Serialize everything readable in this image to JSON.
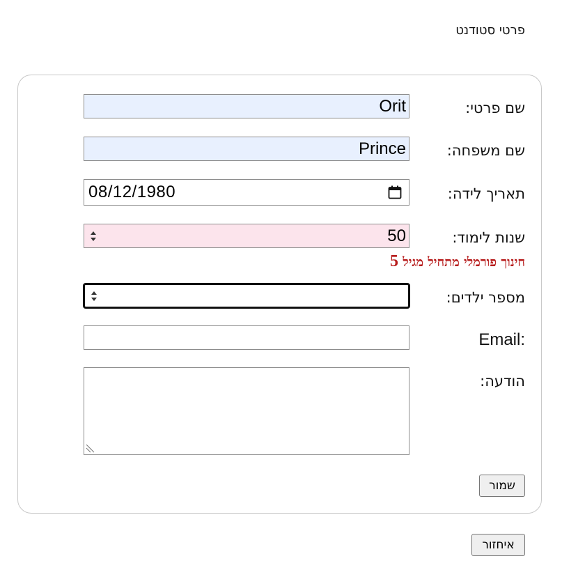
{
  "page": {
    "title": "פרטי סטודנט"
  },
  "form": {
    "first_name": {
      "label": "שם פרטי:",
      "value": "Orit"
    },
    "last_name": {
      "label": "שם משפחה:",
      "value": "Prince"
    },
    "birth_date": {
      "label": "תאריך לידה:",
      "value": "08/12/1980"
    },
    "study_years": {
      "label": "שנות לימוד:",
      "value": "50",
      "error_text": "חינוך פורמלי מתחיל מגיל",
      "error_number": "5"
    },
    "children_count": {
      "label": "מספר ילדים:",
      "value": ""
    },
    "email": {
      "label": ":Email",
      "value": ""
    },
    "message": {
      "label": "הודעה:",
      "value": ""
    },
    "save_label": "שמור"
  },
  "footer": {
    "back_label": "איחזור"
  },
  "colors": {
    "autofill_background": "#e8f0fe",
    "invalid_background": "#fce4ec",
    "error_text": "#b71c1c",
    "button_background": "#efefef"
  },
  "icons": {
    "calendar": "calendar-icon",
    "spinner": "spinner-icon",
    "resize": "resize-grip-icon"
  }
}
